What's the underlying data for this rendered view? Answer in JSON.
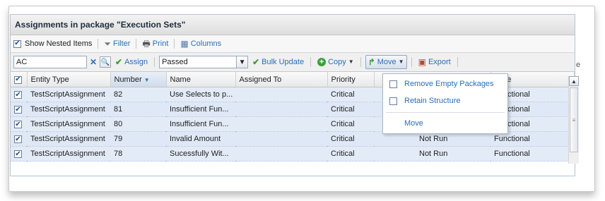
{
  "panel": {
    "title": "Assignments in package \"Execution Sets\""
  },
  "toolbar1": {
    "show_nested_label": "Show Nested Items",
    "show_nested_checked": true,
    "filter_label": "Filter",
    "print_label": "Print",
    "columns_label": "Columns"
  },
  "toolbar2": {
    "search_value": "AC",
    "assign_label": "Assign",
    "status_value": "Passed",
    "bulk_update_label": "Bulk Update",
    "copy_label": "Copy",
    "move_label": "Move",
    "export_label": "Export",
    "overflow_char": "e"
  },
  "table": {
    "columns": [
      "Entity Type",
      "Number",
      "Name",
      "Assigned To",
      "Priority",
      "",
      "Type"
    ],
    "rows": [
      {
        "entity": "TestScriptAssignment",
        "number": "82",
        "name": "Use Selects to p...",
        "assigned": "",
        "priority": "Critical",
        "status": "",
        "type": "Functional"
      },
      {
        "entity": "TestScriptAssignment",
        "number": "81",
        "name": "Insufficient Fun...",
        "assigned": "",
        "priority": "Critical",
        "status": "",
        "type": "Functional"
      },
      {
        "entity": "TestScriptAssignment",
        "number": "80",
        "name": "Insufficient Fun...",
        "assigned": "",
        "priority": "Critical",
        "status": "",
        "type": "Functional"
      },
      {
        "entity": "TestScriptAssignment",
        "number": "79",
        "name": "Invalid Amount",
        "assigned": "",
        "priority": "Critical",
        "status": "Not Run",
        "type": "Functional"
      },
      {
        "entity": "TestScriptAssignment",
        "number": "78",
        "name": "Sucessfully Wit...",
        "assigned": "",
        "priority": "Critical",
        "status": "Not Run",
        "type": "Functional"
      }
    ]
  },
  "move_menu": {
    "remove_empty_label": "Remove Empty Packages",
    "retain_structure_label": "Retain Structure",
    "move_action_label": "Move"
  },
  "colors": {
    "link": "#2a6eb9",
    "row_bg": "#dfe8f6",
    "accent_green": "#3aa13a"
  }
}
